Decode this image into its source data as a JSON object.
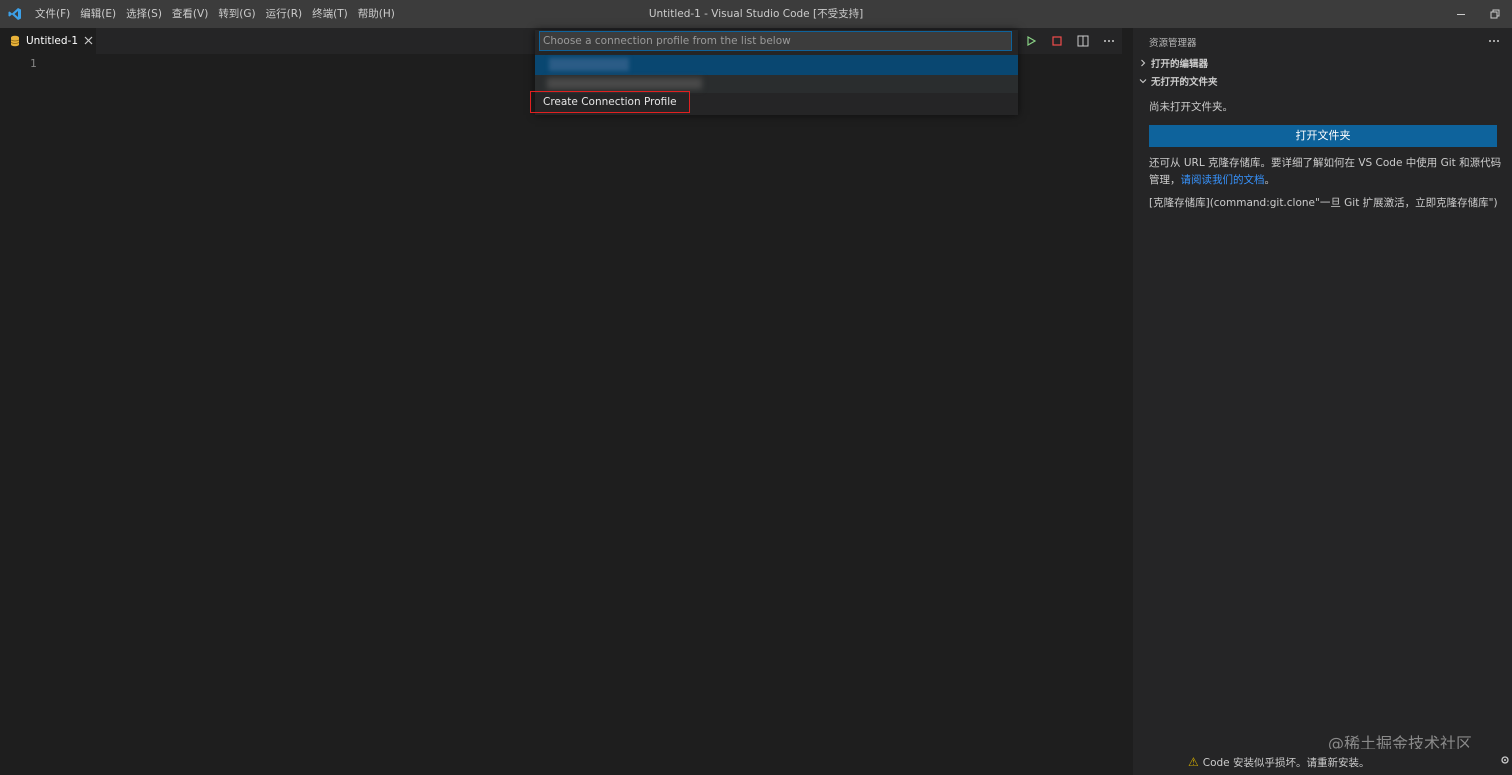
{
  "titlebar": {
    "menu": [
      "文件(F)",
      "编辑(E)",
      "选择(S)",
      "查看(V)",
      "转到(G)",
      "运行(R)",
      "终端(T)",
      "帮助(H)"
    ],
    "window_title": "Untitled-1 - Visual Studio Code [不受支持]"
  },
  "tab": {
    "label": "Untitled-1"
  },
  "editor": {
    "line_number": "1"
  },
  "quickpick": {
    "placeholder": "Choose a connection profile from the list below",
    "create_label": "Create Connection Profile"
  },
  "sidebar": {
    "header": "资源管理器",
    "open_editors": "打开的编辑器",
    "no_folder": "无打开的文件夹",
    "no_folder_msg": "尚未打开文件夹。",
    "open_folder_button": "打开文件夹",
    "clone_text_1": "还可从 URL 克隆存储库。要详细了解如何在 VS Code 中使用 Git 和源代码",
    "clone_text_2a": "管理，",
    "clone_link": "请阅读我们的文档",
    "clone_text_2b": "。",
    "clone_command": "[克隆存储库](command:git.clone\"一旦 Git 扩展激活，立即克隆存储库\")"
  },
  "watermark": "@稀土掘金技术社区",
  "notification": {
    "text": "Code 安装似乎损坏。请重新安装。"
  },
  "colors": {
    "accent": "#0e639c",
    "highlight_border": "#e02020",
    "link": "#3794ff"
  }
}
